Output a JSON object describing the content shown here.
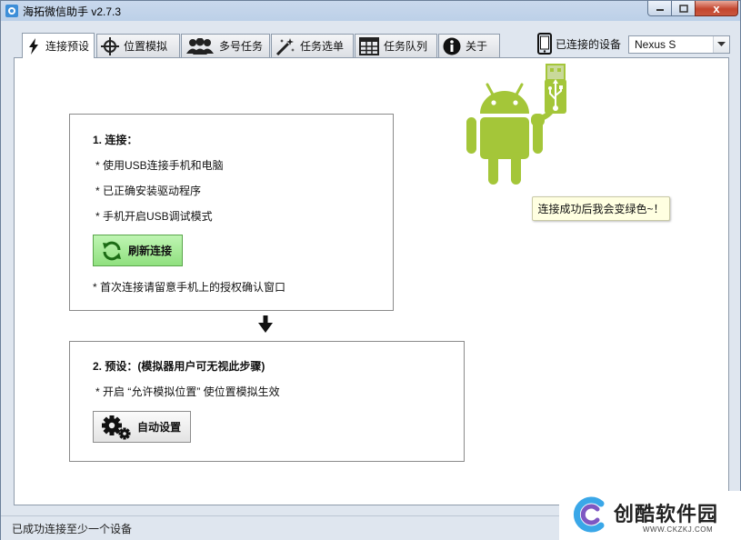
{
  "window": {
    "title": "海拓微信助手 v2.7.3",
    "controls": {
      "minimize": "─",
      "maximize": "□",
      "close": "x"
    }
  },
  "tabs": [
    {
      "label": "连接预设",
      "icon": "lightning-icon",
      "active": true
    },
    {
      "label": "位置模拟",
      "icon": "crosshair-icon",
      "active": false
    },
    {
      "label": "多号任务",
      "icon": "users-icon",
      "active": false
    },
    {
      "label": "任务选单",
      "icon": "magic-wand-icon",
      "active": false
    },
    {
      "label": "任务队列",
      "icon": "table-icon",
      "active": false
    },
    {
      "label": "关于",
      "icon": "info-icon",
      "active": false
    }
  ],
  "device": {
    "label": "已连接的设备",
    "selected": "Nexus S"
  },
  "step1": {
    "heading": "1. 连接：",
    "items": [
      "* 使用USB连接手机和电脑",
      "* 已正确安装驱动程序",
      "* 手机开启USB调试模式"
    ],
    "refresh_button": "刷新连接",
    "note": "* 首次连接请留意手机上的授权确认窗口"
  },
  "step2": {
    "heading": "2. 预设：(模拟器用户可无视此步骤)",
    "item": "* 开启 “允许模拟位置” 使位置模拟生效",
    "auto_button": "自动设置"
  },
  "tooltip": "连接成功后我会变绿色~！",
  "status": "已成功连接至少一个设备",
  "watermark": {
    "name": "创酷软件园",
    "url": "WWW.CKZKJ.COM"
  },
  "colors": {
    "android_green": "#a4c639",
    "refresh_button": "#9fe68e",
    "tooltip_bg": "#ffffe1",
    "watermark_blue": "#3aa7e8"
  }
}
